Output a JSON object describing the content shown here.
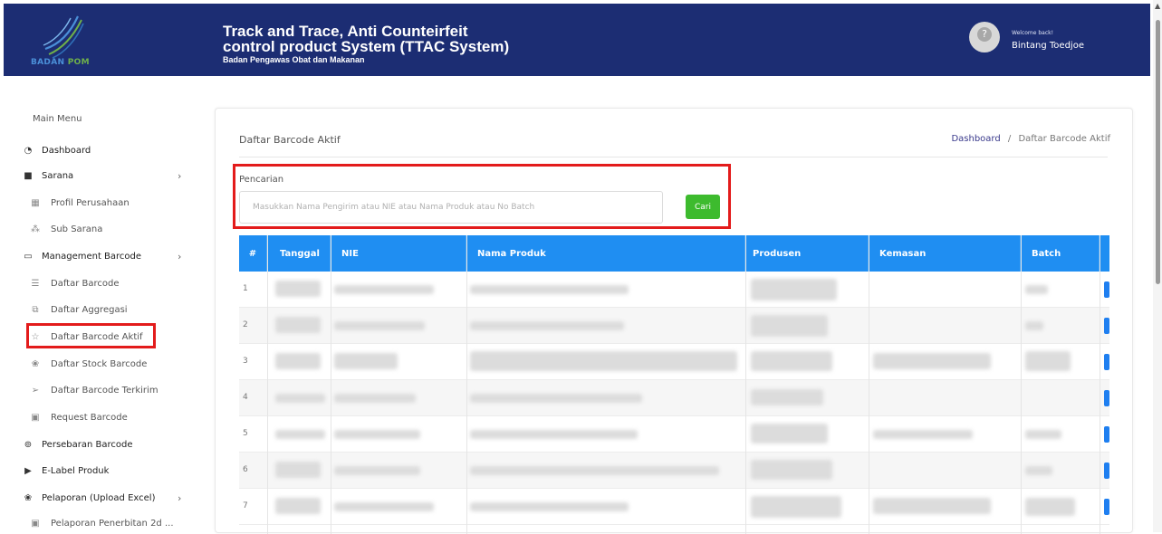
{
  "header": {
    "logo_text_1": "BADAN",
    "logo_text_2": "POM",
    "title_line1": "Track and Trace, Anti Counteirfeit",
    "title_line2": "control product System (TTAC System)",
    "subtitle": "Badan Pengawas Obat dan Makanan",
    "welcome": "Welcome back!",
    "user_name": "Bintang Toedjoe"
  },
  "sidebar": {
    "menu_title": "Main Menu",
    "items": [
      {
        "label": "Dashboard",
        "icon": "gauge-icon"
      },
      {
        "label": "Sarana",
        "icon": "folder-user-icon"
      },
      {
        "label": "Profil Perusahaan",
        "icon": "building-icon"
      },
      {
        "label": "Sub Sarana",
        "icon": "network-icon"
      },
      {
        "label": "Management Barcode",
        "icon": "window-icon"
      },
      {
        "label": "Daftar Barcode",
        "icon": "list-icon"
      },
      {
        "label": "Daftar Aggregasi",
        "icon": "layers-icon"
      },
      {
        "label": "Daftar Barcode Aktif",
        "icon": "star-icon"
      },
      {
        "label": "Daftar Stock Barcode",
        "icon": "gift-icon"
      },
      {
        "label": "Daftar Barcode Terkirim",
        "icon": "send-icon"
      },
      {
        "label": "Request Barcode",
        "icon": "monitor-icon"
      },
      {
        "label": "Persebaran Barcode",
        "icon": "map-pin-icon"
      },
      {
        "label": "E-Label Produk",
        "icon": "tag-icon"
      },
      {
        "label": "Pelaporan (Upload Excel)",
        "icon": "gift-icon"
      },
      {
        "label": "Pelaporan Penerbitan 2d ...",
        "icon": "monitor-icon"
      }
    ]
  },
  "main": {
    "page_title": "Daftar Barcode Aktif",
    "breadcrumb_link": "Dashboard",
    "breadcrumb_sep": "/",
    "breadcrumb_current": "Daftar Barcode Aktif",
    "search_label": "Pencarian",
    "search_placeholder": "Masukkan Nama Pengirim atau NIE atau Nama Produk atau No Batch",
    "search_button": "Cari",
    "columns": [
      "#",
      "Tanggal",
      "NIE",
      "Nama Produk",
      "Produsen",
      "Kemasan",
      "Batch"
    ],
    "row_numbers": [
      "1",
      "2",
      "3",
      "4",
      "5",
      "6",
      "7"
    ]
  },
  "colors": {
    "header_bg": "#1c2d73",
    "table_header": "#1f8ef2",
    "button_green": "#3dbb2e",
    "highlight_red": "#e31b1b"
  }
}
